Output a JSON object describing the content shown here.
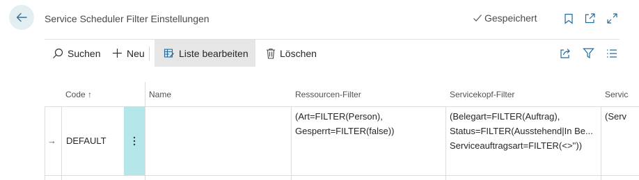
{
  "header": {
    "title": "Service Scheduler Filter Einstellungen",
    "saved_label": "Gespeichert",
    "back_icon": "arrow-left-icon",
    "bookmark_icon": "bookmark-icon",
    "open_new_icon": "open-new-window-icon",
    "expand_icon": "expand-icon"
  },
  "actions": {
    "search_label": "Suchen",
    "new_label": "Neu",
    "edit_list_label": "Liste bearbeiten",
    "delete_label": "Löschen",
    "share_icon": "share-icon",
    "filter_icon": "filter-icon",
    "list_view_icon": "list-view-icon"
  },
  "table": {
    "columns": [
      "Code",
      "Name",
      "Ressourcen-Filter",
      "Servicekopf-Filter",
      "Servic"
    ],
    "sort_indicator": "↑",
    "rows": [
      {
        "code": "DEFAULT",
        "name": "",
        "resource_filter": [
          "(Art=FILTER(Person),",
          "Gesperrt=FILTER(false))"
        ],
        "service_header_filter": [
          "(Belegart=FILTER(Auftrag),",
          "Status=FILTER(Ausstehend|In Be...",
          "Serviceauftragsart=FILTER(<>''))"
        ],
        "next_filter": "(Serv"
      }
    ]
  },
  "colors": {
    "accent_selected": "#b5e6ea",
    "back_button_bg": "#e3eef3",
    "active_action_bg": "#e6e6e6",
    "icon_color": "#1f6b9e"
  }
}
